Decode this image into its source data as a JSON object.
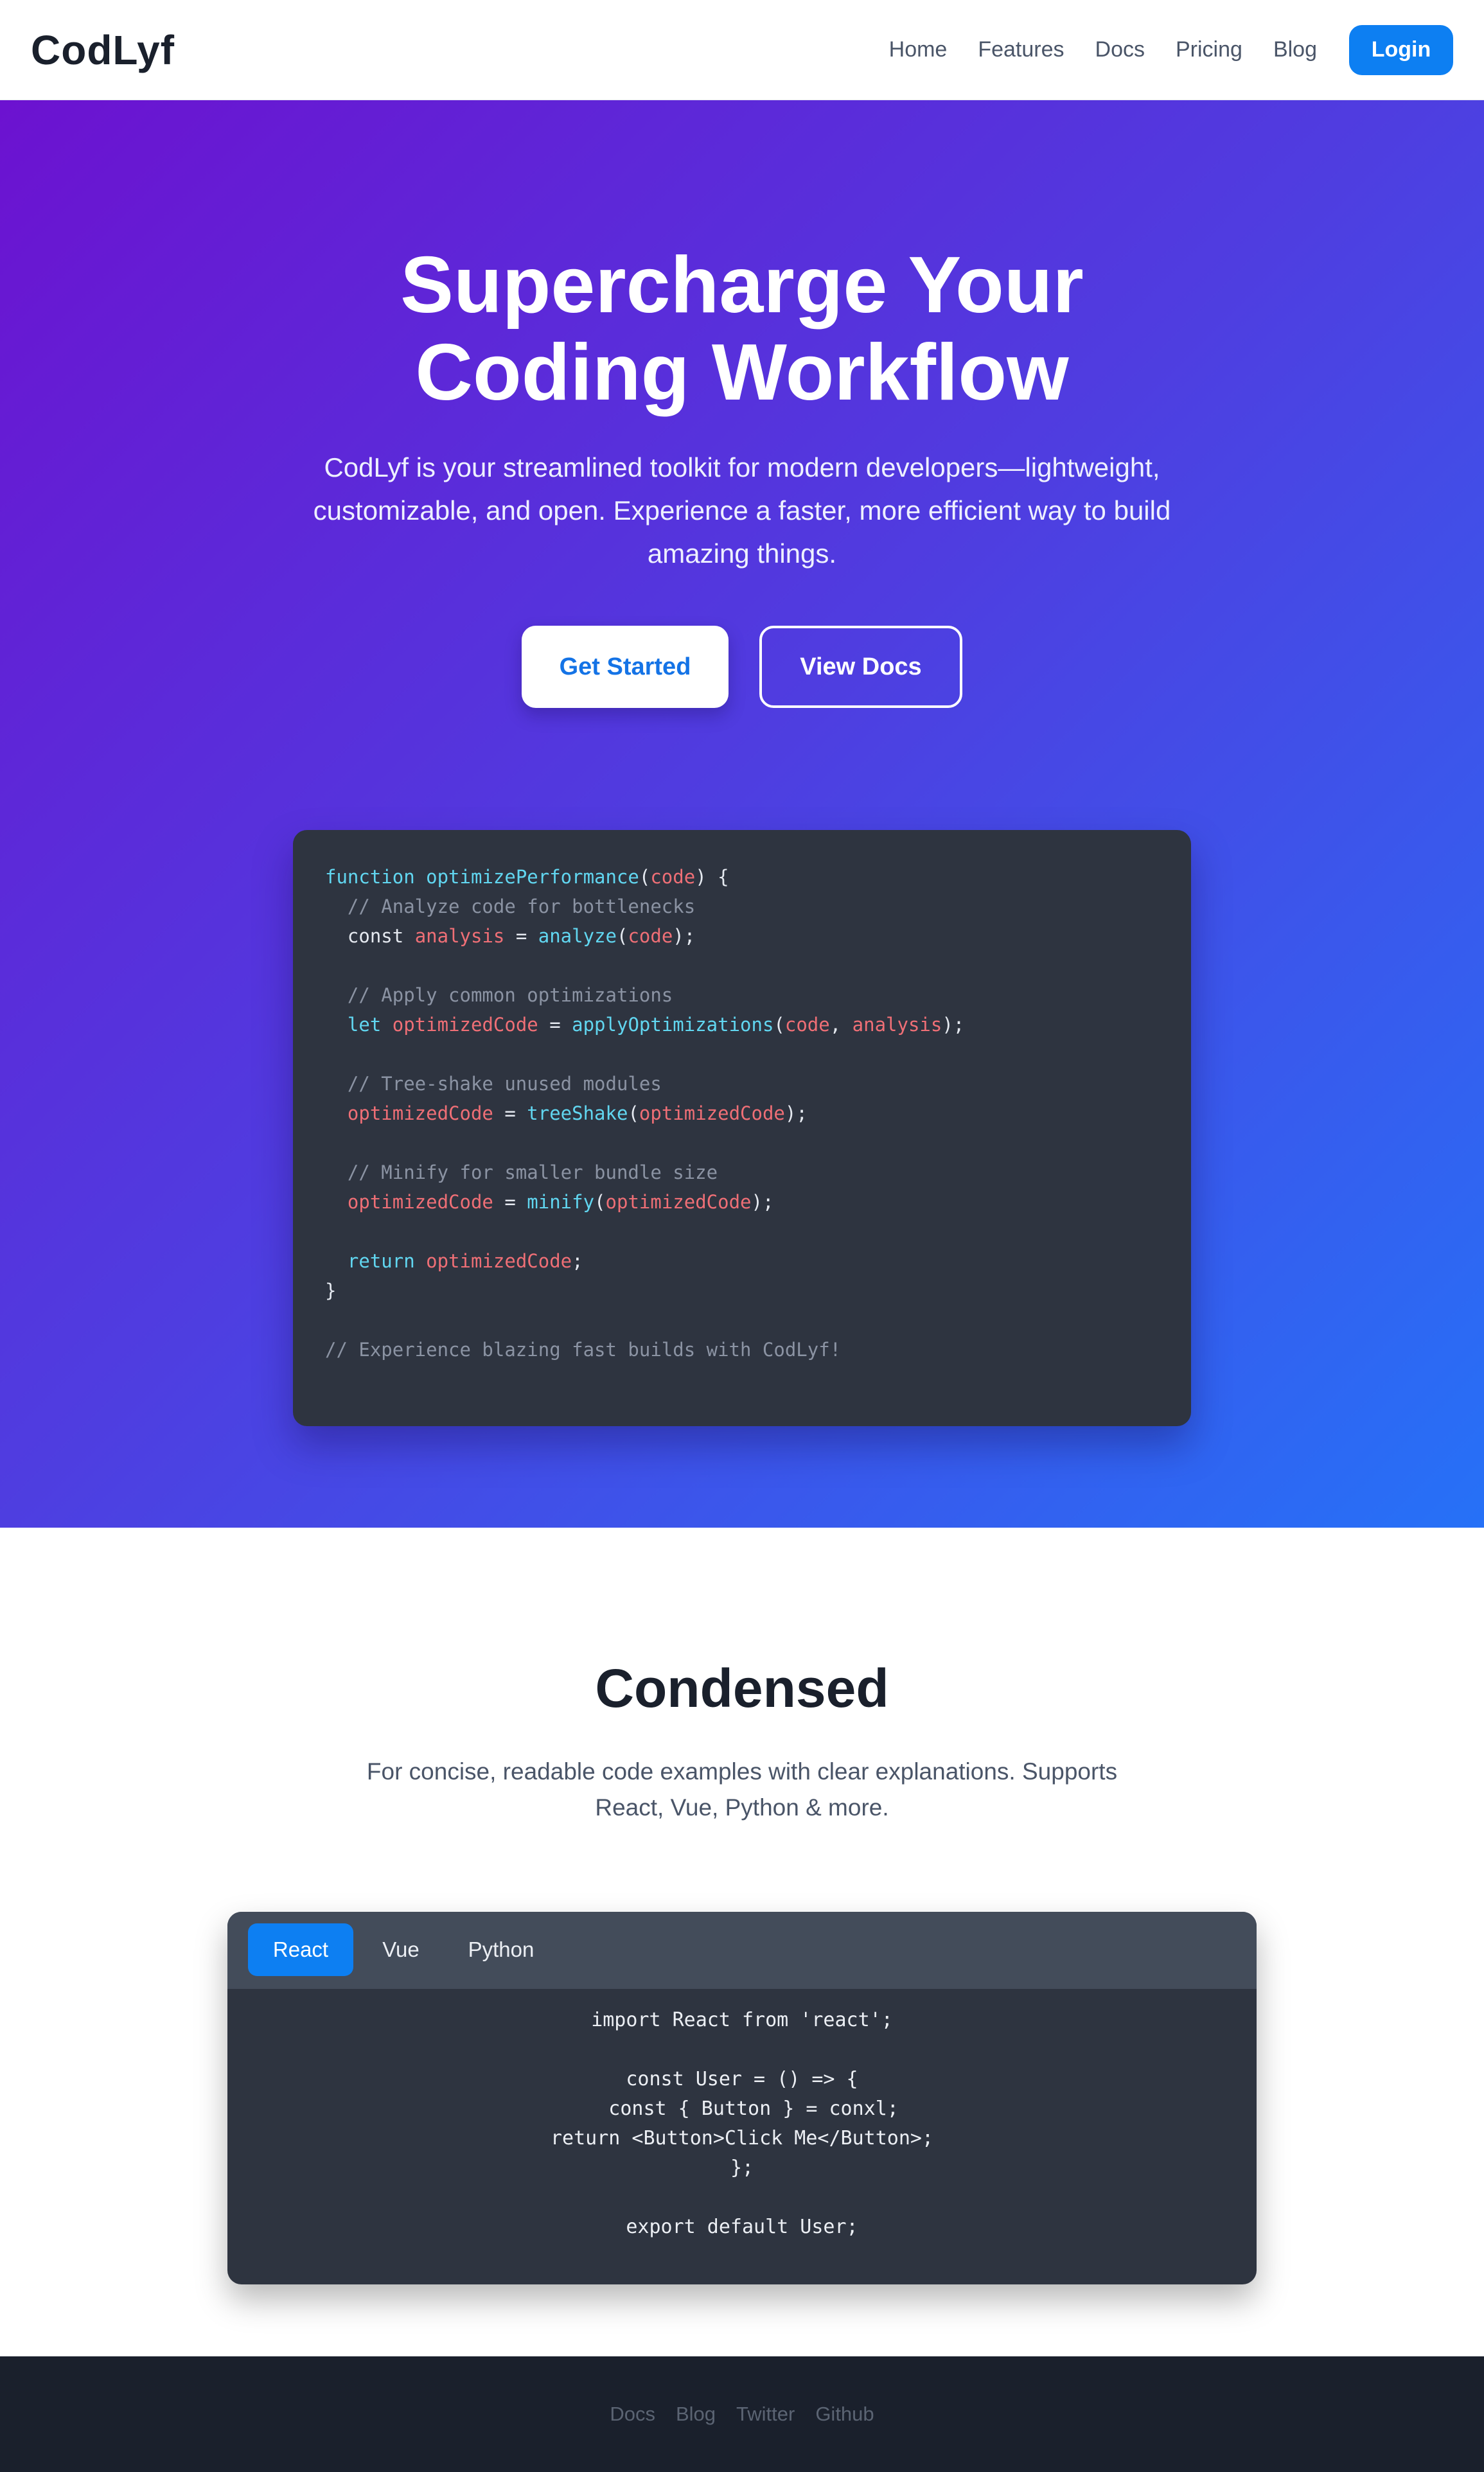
{
  "nav": {
    "logo": "CodLyf",
    "links": [
      "Home",
      "Features",
      "Docs",
      "Pricing",
      "Blog"
    ],
    "login_label": "Login"
  },
  "hero": {
    "title_line1": "Supercharge Your",
    "title_line2": "Coding Workflow",
    "subtitle": "CodLyf is your streamlined toolkit for modern developers—lightweight, customizable, and open. Experience a faster, more efficient way to build amazing things.",
    "primary_cta": "Get Started",
    "secondary_cta": "View Docs"
  },
  "hero_code": {
    "lines": [
      [
        [
          "kw",
          "function "
        ],
        [
          "fn",
          "optimizePerformance"
        ],
        [
          "pl",
          "("
        ],
        [
          "var",
          "code"
        ],
        [
          "pl",
          ") {"
        ]
      ],
      [
        [
          "cm",
          "  // Analyze code for bottlenecks"
        ]
      ],
      [
        [
          "pl",
          "  const "
        ],
        [
          "var",
          "analysis"
        ],
        [
          "pl",
          " = "
        ],
        [
          "fn",
          "analyze"
        ],
        [
          "pl",
          "("
        ],
        [
          "var",
          "code"
        ],
        [
          "pl",
          ");"
        ]
      ],
      [],
      [
        [
          "cm",
          "  // Apply common optimizations"
        ]
      ],
      [
        [
          "kw",
          "  let "
        ],
        [
          "var",
          "optimizedCode"
        ],
        [
          "pl",
          " = "
        ],
        [
          "fn",
          "applyOptimizations"
        ],
        [
          "pl",
          "("
        ],
        [
          "var",
          "code"
        ],
        [
          "pl",
          ", "
        ],
        [
          "var",
          "analysis"
        ],
        [
          "pl",
          ");"
        ]
      ],
      [],
      [
        [
          "cm",
          "  // Tree-shake unused modules"
        ]
      ],
      [
        [
          "var",
          "  optimizedCode"
        ],
        [
          "pl",
          " = "
        ],
        [
          "fn",
          "treeShake"
        ],
        [
          "pl",
          "("
        ],
        [
          "var",
          "optimizedCode"
        ],
        [
          "pl",
          ");"
        ]
      ],
      [],
      [
        [
          "cm",
          "  // Minify for smaller bundle size"
        ]
      ],
      [
        [
          "var",
          "  optimizedCode"
        ],
        [
          "pl",
          " = "
        ],
        [
          "fn",
          "minify"
        ],
        [
          "pl",
          "("
        ],
        [
          "var",
          "optimizedCode"
        ],
        [
          "pl",
          ");"
        ]
      ],
      [],
      [
        [
          "kw",
          "  return "
        ],
        [
          "var",
          "optimizedCode"
        ],
        [
          "pl",
          ";"
        ]
      ],
      [
        [
          "pl",
          "}"
        ]
      ],
      [],
      [
        [
          "cm",
          "// Experience blazing fast builds with CodLyf!"
        ]
      ]
    ]
  },
  "condensed": {
    "title": "Condensed",
    "subtitle": "For concise, readable code examples with clear explanations. Supports React, Vue, Python & more."
  },
  "code_tabs": {
    "tabs": [
      "React",
      "Vue",
      "Python"
    ],
    "active_tab": "React",
    "code_lines": [
      "import React from 'react';",
      "",
      "const User = () => {",
      "  const { Button } = conxl;",
      "return <Button>Click Me</Button>;",
      "};",
      "",
      "export default User;"
    ]
  },
  "footer": {
    "links": [
      "Docs",
      "Blog",
      "Twitter",
      "Github"
    ]
  }
}
